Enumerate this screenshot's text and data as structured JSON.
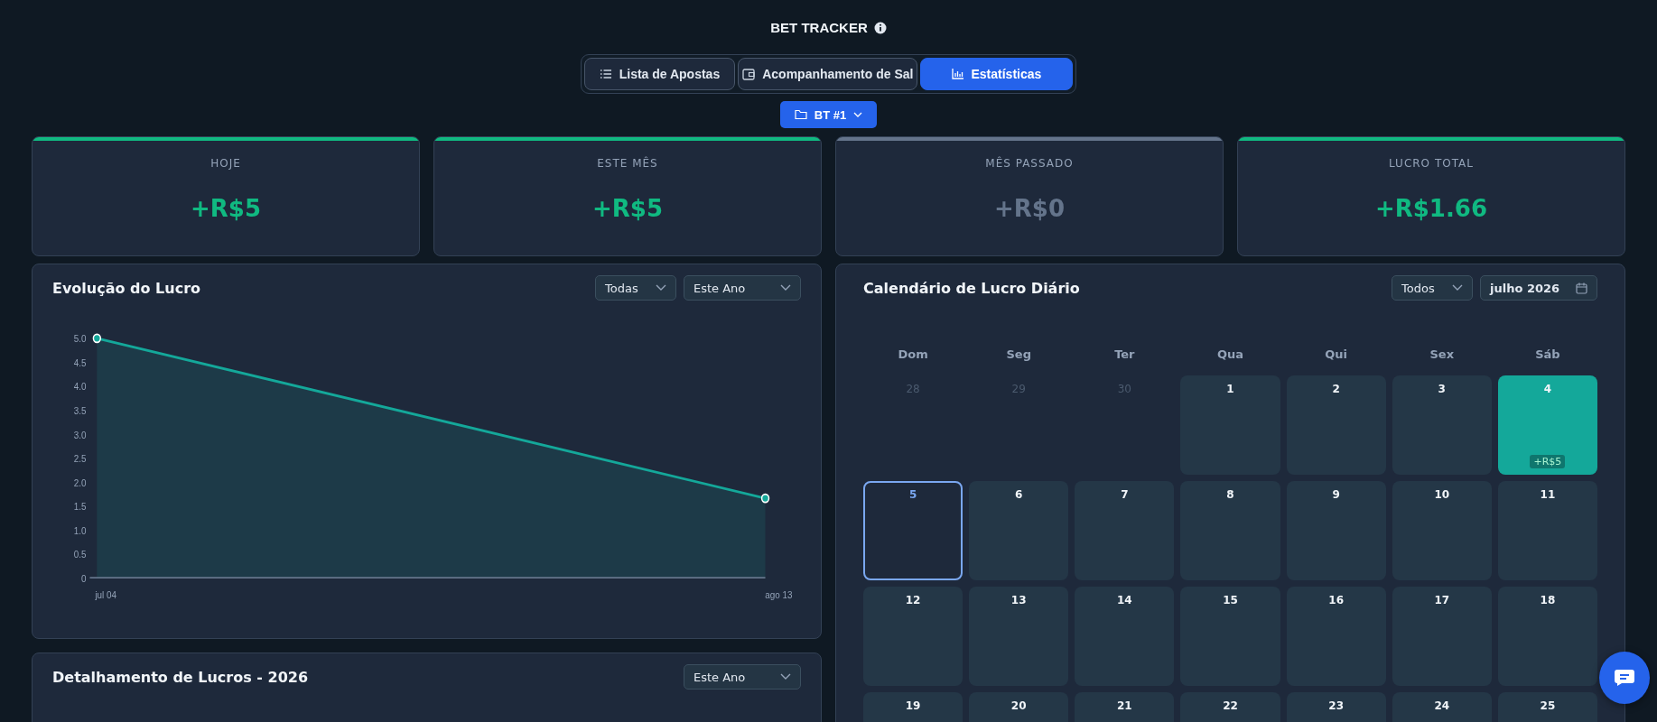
{
  "header": {
    "title": "BET TRACKER"
  },
  "tabs": [
    {
      "label": "Lista de Apostas",
      "kind": "list",
      "selected": false
    },
    {
      "label": "Acompanhamento de Sal",
      "kind": "wallet",
      "selected": false
    },
    {
      "label": "Estatísticas",
      "kind": "chart",
      "selected": true
    }
  ],
  "tracker_button": {
    "label": "BT #1"
  },
  "stats": [
    {
      "label": "HOJE",
      "value": "+R$5",
      "color": "#10b981"
    },
    {
      "label": "ESTE MÊS",
      "value": "+R$5",
      "color": "#10b981"
    },
    {
      "label": "MÊS PASSADO",
      "value": "+R$0",
      "color": "#64748b"
    },
    {
      "label": "LUCRO TOTAL",
      "value": "+R$1.66",
      "color": "#10b981"
    }
  ],
  "profit_chart": {
    "title": "Evolução do Lucro",
    "filters": [
      "Todas",
      "Este Ano"
    ],
    "chart_data": {
      "type": "area",
      "categories": [
        "jul 04",
        "ago 13"
      ],
      "series": [
        {
          "color": "#14a89a",
          "values": [
            5.0,
            1.66
          ]
        }
      ],
      "ylim": [
        0,
        5
      ],
      "yticks": [
        {
          "value": 0,
          "label": "0"
        },
        {
          "value": 0.5,
          "label": "0.5"
        },
        {
          "value": 1,
          "label": "1.0"
        },
        {
          "value": 1.5,
          "label": "1.5"
        },
        {
          "value": 2,
          "label": "2.0"
        },
        {
          "value": 2.5,
          "label": "2.5"
        },
        {
          "value": 3,
          "label": "3.0"
        },
        {
          "value": 3.5,
          "label": "3.5"
        },
        {
          "value": 4,
          "label": "4.0"
        },
        {
          "value": 4.5,
          "label": "4.5"
        },
        {
          "value": 5,
          "label": "5.0"
        }
      ]
    }
  },
  "breakdown": {
    "title": "Detalhamento de Lucros - 2026",
    "filter": "Este Ano"
  },
  "calendar": {
    "title": "Calendário de Lucro Diário",
    "filter": "Todos",
    "month": "julho 2026",
    "weekdays": [
      "Dom",
      "Seg",
      "Ter",
      "Qua",
      "Qui",
      "Sex",
      "Sáb"
    ],
    "days": [
      {
        "day": "28",
        "kind": "outside",
        "today": false
      },
      {
        "day": "29",
        "kind": "outside",
        "today": false
      },
      {
        "day": "30",
        "kind": "outside",
        "today": false
      },
      {
        "day": "1",
        "kind": "empty",
        "today": false
      },
      {
        "day": "2",
        "kind": "empty",
        "today": false
      },
      {
        "day": "3",
        "kind": "empty",
        "today": false
      },
      {
        "day": "4",
        "kind": "profit",
        "today": false,
        "profit": "+R$5"
      },
      {
        "day": "5",
        "kind": "empty",
        "today": true
      },
      {
        "day": "6",
        "kind": "empty",
        "today": false
      },
      {
        "day": "7",
        "kind": "empty",
        "today": false
      },
      {
        "day": "8",
        "kind": "empty",
        "today": false
      },
      {
        "day": "9",
        "kind": "empty",
        "today": false
      },
      {
        "day": "10",
        "kind": "empty",
        "today": false
      },
      {
        "day": "11",
        "kind": "empty",
        "today": false
      },
      {
        "day": "12",
        "kind": "empty",
        "today": false
      },
      {
        "day": "13",
        "kind": "empty",
        "today": false
      },
      {
        "day": "14",
        "kind": "empty",
        "today": false
      },
      {
        "day": "15",
        "kind": "empty",
        "today": false
      },
      {
        "day": "16",
        "kind": "empty",
        "today": false
      },
      {
        "day": "17",
        "kind": "empty",
        "today": false
      },
      {
        "day": "18",
        "kind": "empty",
        "today": false
      },
      {
        "day": "19",
        "kind": "empty",
        "today": false
      },
      {
        "day": "20",
        "kind": "empty",
        "today": false
      },
      {
        "day": "21",
        "kind": "empty",
        "today": false
      },
      {
        "day": "22",
        "kind": "empty",
        "today": false
      },
      {
        "day": "23",
        "kind": "empty",
        "today": false
      },
      {
        "day": "24",
        "kind": "empty",
        "today": false
      },
      {
        "day": "25",
        "kind": "empty",
        "today": false
      }
    ]
  }
}
